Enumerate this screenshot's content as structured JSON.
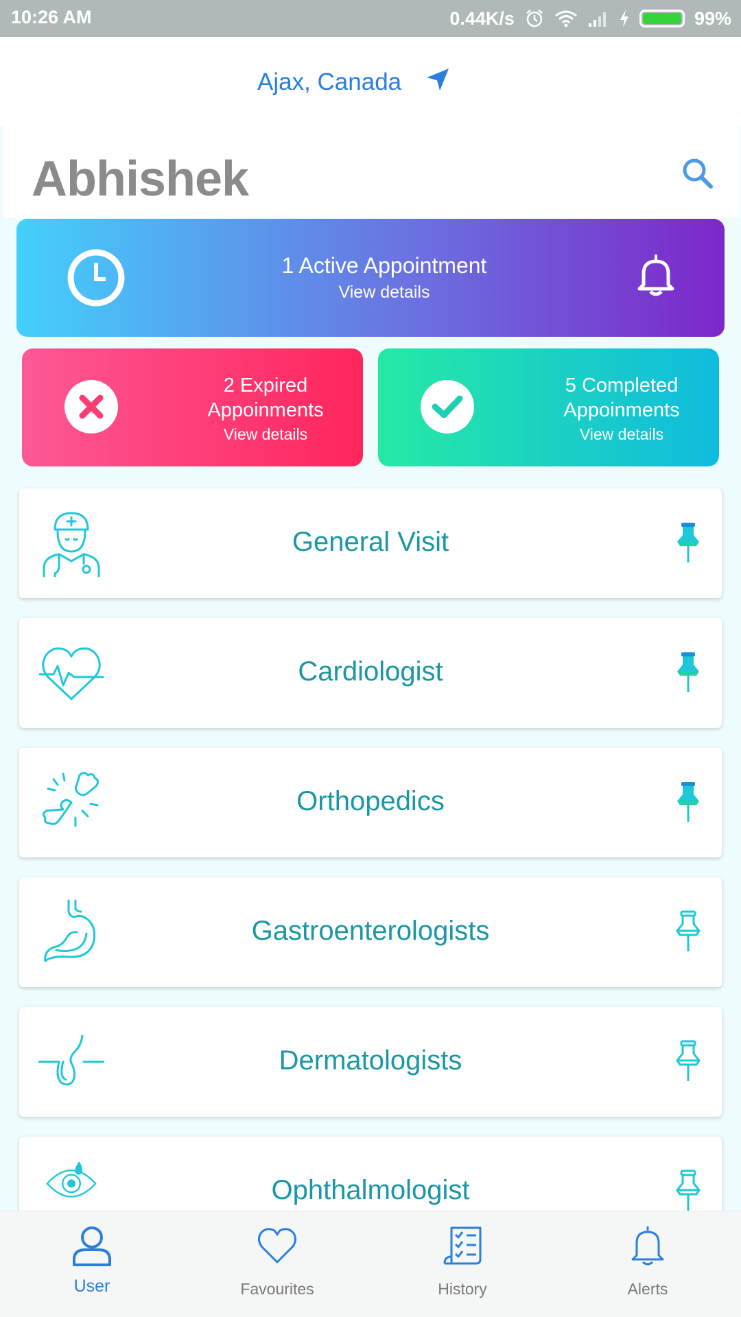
{
  "status_bar": {
    "time": "10:26 AM",
    "network_speed": "0.44K/s",
    "battery": "99%",
    "battery_level": 0.99
  },
  "location": {
    "text": "Ajax, Canada",
    "icon": "navigation-arrow-icon"
  },
  "header": {
    "user_name": "Abhishek",
    "search_icon": "search-icon"
  },
  "active_card": {
    "title": "1  Active Appointment",
    "link": "View details",
    "colors": [
      "#43d0fb",
      "#7d27c9"
    ]
  },
  "expired_card": {
    "line1": "2 Expired",
    "line2": "Appoinments",
    "link": "View details",
    "colors": [
      "#fd5896",
      "#fe255c"
    ]
  },
  "completed_card": {
    "line1": "5 Completed",
    "line2": "Appoinments",
    "link": "View details",
    "colors": [
      "#26e9a5",
      "#10bbde"
    ]
  },
  "specialties": [
    {
      "label": "General Visit",
      "icon": "nurse-icon",
      "pinned": true
    },
    {
      "label": "Cardiologist",
      "icon": "heart-pulse-icon",
      "pinned": true
    },
    {
      "label": "Orthopedics",
      "icon": "bone-joint-icon",
      "pinned": true
    },
    {
      "label": "Gastroenterologists",
      "icon": "stomach-icon",
      "pinned": false
    },
    {
      "label": "Dermatologists",
      "icon": "skin-hair-icon",
      "pinned": false
    },
    {
      "label": "Ophthalmologist",
      "icon": "eye-icon",
      "pinned": false
    }
  ],
  "bottom_nav": [
    {
      "label": "User",
      "icon": "user-icon",
      "active": true
    },
    {
      "label": "Favourites",
      "icon": "heart-icon",
      "active": false
    },
    {
      "label": "History",
      "icon": "checklist-icon",
      "active": false
    },
    {
      "label": "Alerts",
      "icon": "bell-icon",
      "active": false
    }
  ],
  "colors": {
    "accent_blue": "#2a7fde",
    "teal_text": "#1a97a4",
    "pin_filled": "#1ec8d8",
    "name_gray": "#8b8b8b"
  }
}
